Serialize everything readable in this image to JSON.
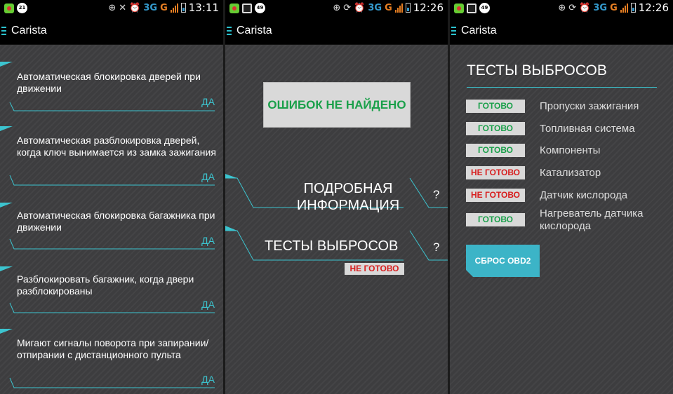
{
  "app_title": "Carista",
  "colors": {
    "accent": "#3cc4cf",
    "ok_text": "#1aa04a",
    "bad_text": "#d81e1e",
    "background": "#3d3d3f"
  },
  "panel1": {
    "status": {
      "time": "13:11",
      "notif_count": "21",
      "network_3g": "3G",
      "network_g": "G"
    },
    "settings": [
      {
        "label": "Автоматическая блокировка дверей при движении",
        "value": "ДА"
      },
      {
        "label": "Автоматическая разблокировка дверей, когда ключ вынимается из замка зажигания",
        "value": "ДА"
      },
      {
        "label": "Автоматическая блокировка багажника при движении",
        "value": "ДА"
      },
      {
        "label": "Разблокировать багажник, когда двери разблокированы",
        "value": "ДА"
      },
      {
        "label": "Мигают сигналы поворота при запирании/отпирании с дистанционного пульта",
        "value": "ДА"
      }
    ]
  },
  "panel2": {
    "status": {
      "time": "12:26",
      "notif_count": "49",
      "network_3g": "3G",
      "network_g": "G"
    },
    "no_errors": "ОШИБОК НЕ НАЙДЕНО",
    "details_label": "ПОДРОБНАЯ ИНФОРМАЦИЯ",
    "details_help": "?",
    "emissions_label": "ТЕСТЫ ВЫБРОСОВ",
    "emissions_help": "?",
    "emissions_status": "НЕ ГОТОВО"
  },
  "panel3": {
    "status": {
      "time": "12:26",
      "notif_count": "49",
      "network_3g": "3G",
      "network_g": "G"
    },
    "title": "ТЕСТЫ ВЫБРОСОВ",
    "tests": [
      {
        "status": "ГОТОВО",
        "ok": true,
        "name": "Пропуски зажигания"
      },
      {
        "status": "ГОТОВО",
        "ok": true,
        "name": "Топливная система"
      },
      {
        "status": "ГОТОВО",
        "ok": true,
        "name": "Компоненты"
      },
      {
        "status": "НЕ ГОТОВО",
        "ok": false,
        "name": "Катализатор"
      },
      {
        "status": "НЕ ГОТОВО",
        "ok": false,
        "name": "Датчик кислорода"
      },
      {
        "status": "ГОТОВО",
        "ok": true,
        "name": "Нагреватель датчика кислорода"
      }
    ],
    "reset_button": "СБРОС OBD2"
  }
}
